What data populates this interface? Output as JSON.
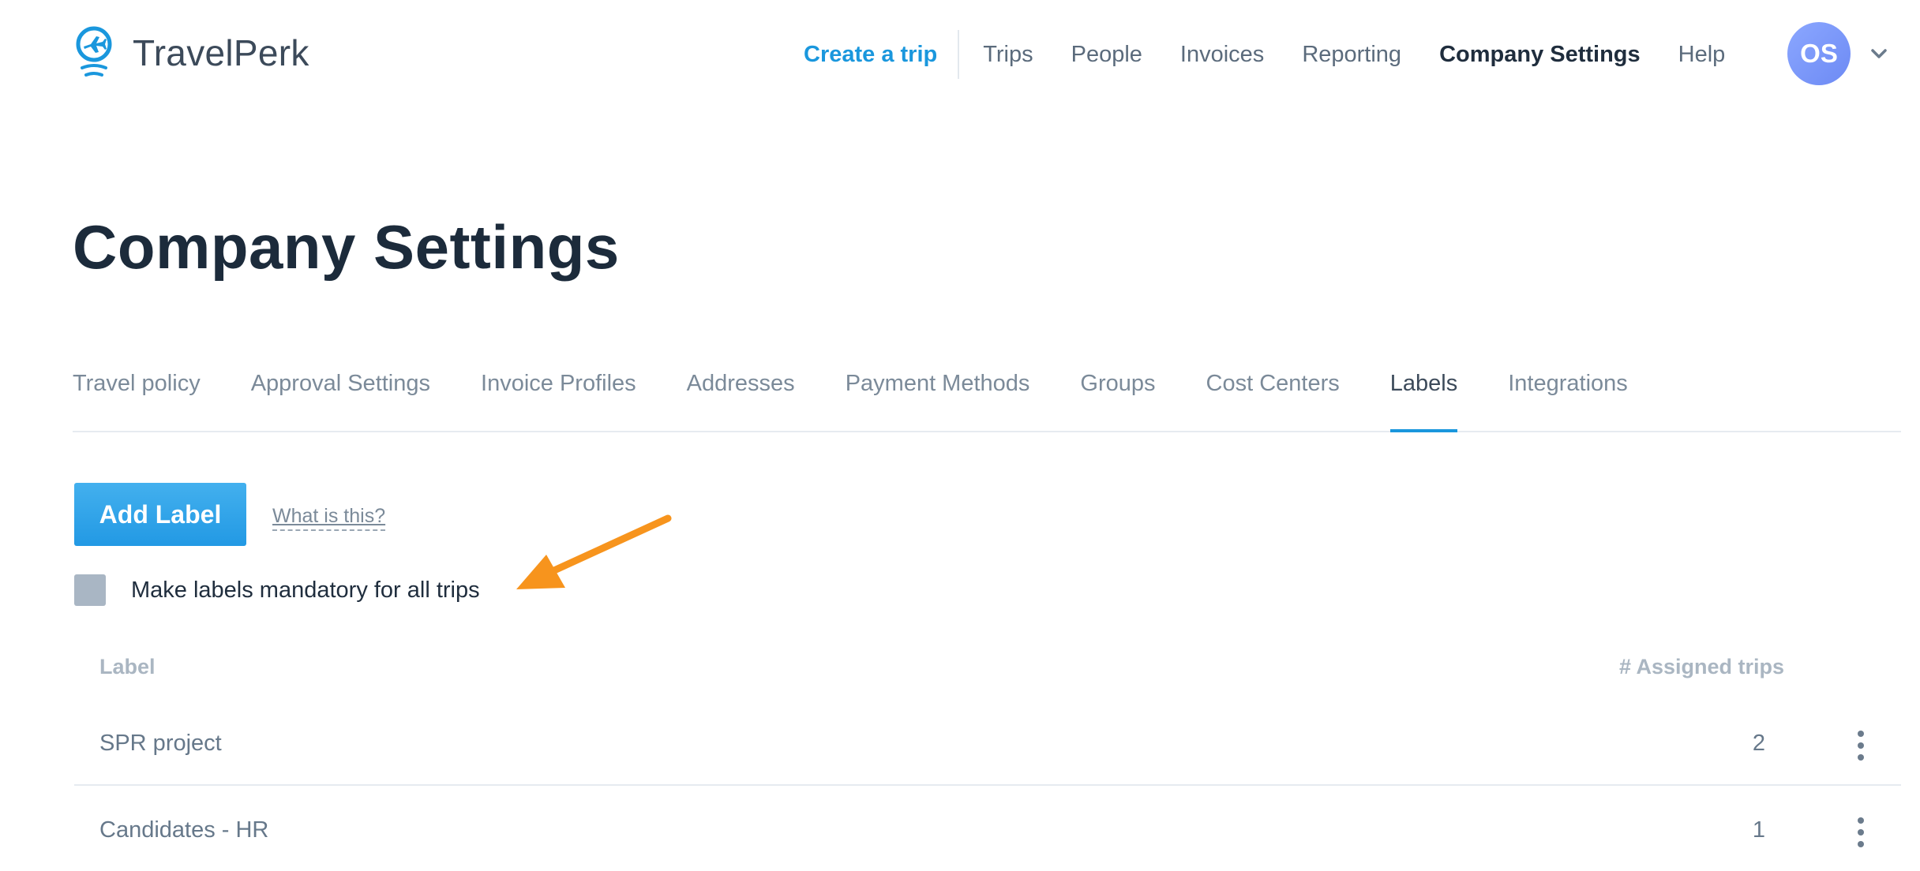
{
  "brand": {
    "name": "TravelPerk",
    "accent_color": "#1a97dd"
  },
  "header": {
    "create_trip": "Create a trip",
    "nav": [
      "Trips",
      "People",
      "Invoices",
      "Reporting",
      "Company Settings",
      "Help"
    ],
    "active_nav": "Company Settings",
    "avatar_initials": "OS",
    "user_menu_icon": "chevron-down-icon"
  },
  "page": {
    "title": "Company Settings"
  },
  "tabs": {
    "items": [
      "Travel policy",
      "Approval Settings",
      "Invoice Profiles",
      "Addresses",
      "Payment Methods",
      "Groups",
      "Cost Centers",
      "Labels",
      "Integrations"
    ],
    "active": "Labels"
  },
  "labels_section": {
    "add_button": "Add Label",
    "help_link": "What is this?",
    "mandatory_checkbox_label": "Make labels mandatory for all trips",
    "mandatory_checked": false,
    "annotation_arrow_color": "#f7941d"
  },
  "table": {
    "columns": [
      "Label",
      "# Assigned trips"
    ],
    "rows": [
      {
        "label": "SPR project",
        "assigned_trips": "2"
      },
      {
        "label": "Candidates - HR",
        "assigned_trips": "1"
      }
    ],
    "row_menu_icon": "more-vertical-icon"
  }
}
